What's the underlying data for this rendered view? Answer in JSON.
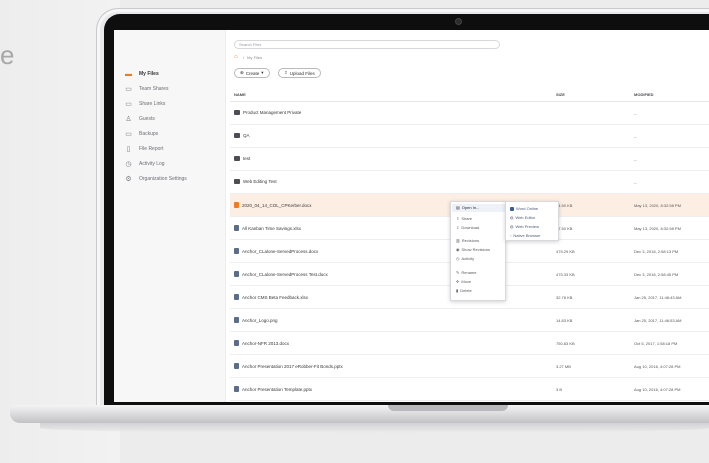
{
  "marketing": {
    "side_text": "e"
  },
  "app": {
    "search_placeholder": "Search Files",
    "breadcrumb": "My Files",
    "toolbar": {
      "create_label": "Create",
      "upload_label": "Upload Files"
    }
  },
  "sidebar": {
    "items": [
      {
        "label": "My Files",
        "icon": "folder-icon"
      },
      {
        "label": "Team Shares",
        "icon": "team-folder-icon"
      },
      {
        "label": "Share Links",
        "icon": "link-folder-icon"
      },
      {
        "label": "Guests",
        "icon": "user-icon"
      },
      {
        "label": "Backups",
        "icon": "backup-icon"
      },
      {
        "label": "File Report",
        "icon": "report-icon"
      },
      {
        "label": "Activity Log",
        "icon": "clock-icon"
      },
      {
        "label": "Organization Settings",
        "icon": "gear-icon"
      }
    ]
  },
  "table": {
    "headers": {
      "name": "NAME",
      "size": "SIZE",
      "modified": "MODIFIED"
    },
    "rows": [
      {
        "name": "Product Management Private",
        "size": "",
        "modified": "--",
        "type": "folder"
      },
      {
        "name": "QA",
        "size": "",
        "modified": "--",
        "type": "folder"
      },
      {
        "name": "test",
        "size": "",
        "modified": "--",
        "type": "folder"
      },
      {
        "name": "Web Editing Test",
        "size": "",
        "modified": "--",
        "type": "folder"
      },
      {
        "name": "2020_04_14_COL_CPKerber.docx",
        "size": "14.50 KB",
        "modified": "May 13, 2020, 8:32:58 PM",
        "type": "doc-selected"
      },
      {
        "name": "All Kanban Time Savings.xlsx",
        "size": "17.50 KB",
        "modified": "May 13, 2020, 8:32:58 PM",
        "type": "doc"
      },
      {
        "name": "Anchor_CLalone-ServedProcess.docx",
        "size": "475.29 KB",
        "modified": "Dec 3, 2018, 2:58:13 PM",
        "type": "doc"
      },
      {
        "name": "Anchor_CLalone-ServedProcess Test.docx",
        "size": "475.33 KB",
        "modified": "Dec 3, 2018, 2:58:45 PM",
        "type": "doc"
      },
      {
        "name": "Anchor CMS Beta Feedback.xlsx",
        "size": "32.78 KB",
        "modified": "Jan 25, 2017, 11:46:43 AM",
        "type": "doc"
      },
      {
        "name": "Anchor_Logo.png",
        "size": "14.83 KB",
        "modified": "Jan 25, 2017, 11:46:53 AM",
        "type": "doc"
      },
      {
        "name": "Anchor-NFR 2013.docx",
        "size": "750.83 KB",
        "modified": "Oct 5, 2017, 1:58:18 PM",
        "type": "doc"
      },
      {
        "name": "Anchor Presentation 2017 eRobber-Fit Bonds.pptx",
        "size": "3.27 MB",
        "modified": "Aug 10, 2016, 4:07:28 PM",
        "type": "doc"
      },
      {
        "name": "Anchor Presentation Template.pptx",
        "size": "3 B",
        "modified": "Aug 10, 2016, 4:07:28 PM",
        "type": "doc"
      }
    ]
  },
  "context_menu": {
    "items": [
      "Open In...",
      "Share",
      "Download",
      "Revisions",
      "Show Revisions",
      "Activity",
      "Rename",
      "Move",
      "Delete"
    ],
    "submenu": [
      "Word Online",
      "Web Editor",
      "Web Preview",
      "Native Browser"
    ]
  }
}
